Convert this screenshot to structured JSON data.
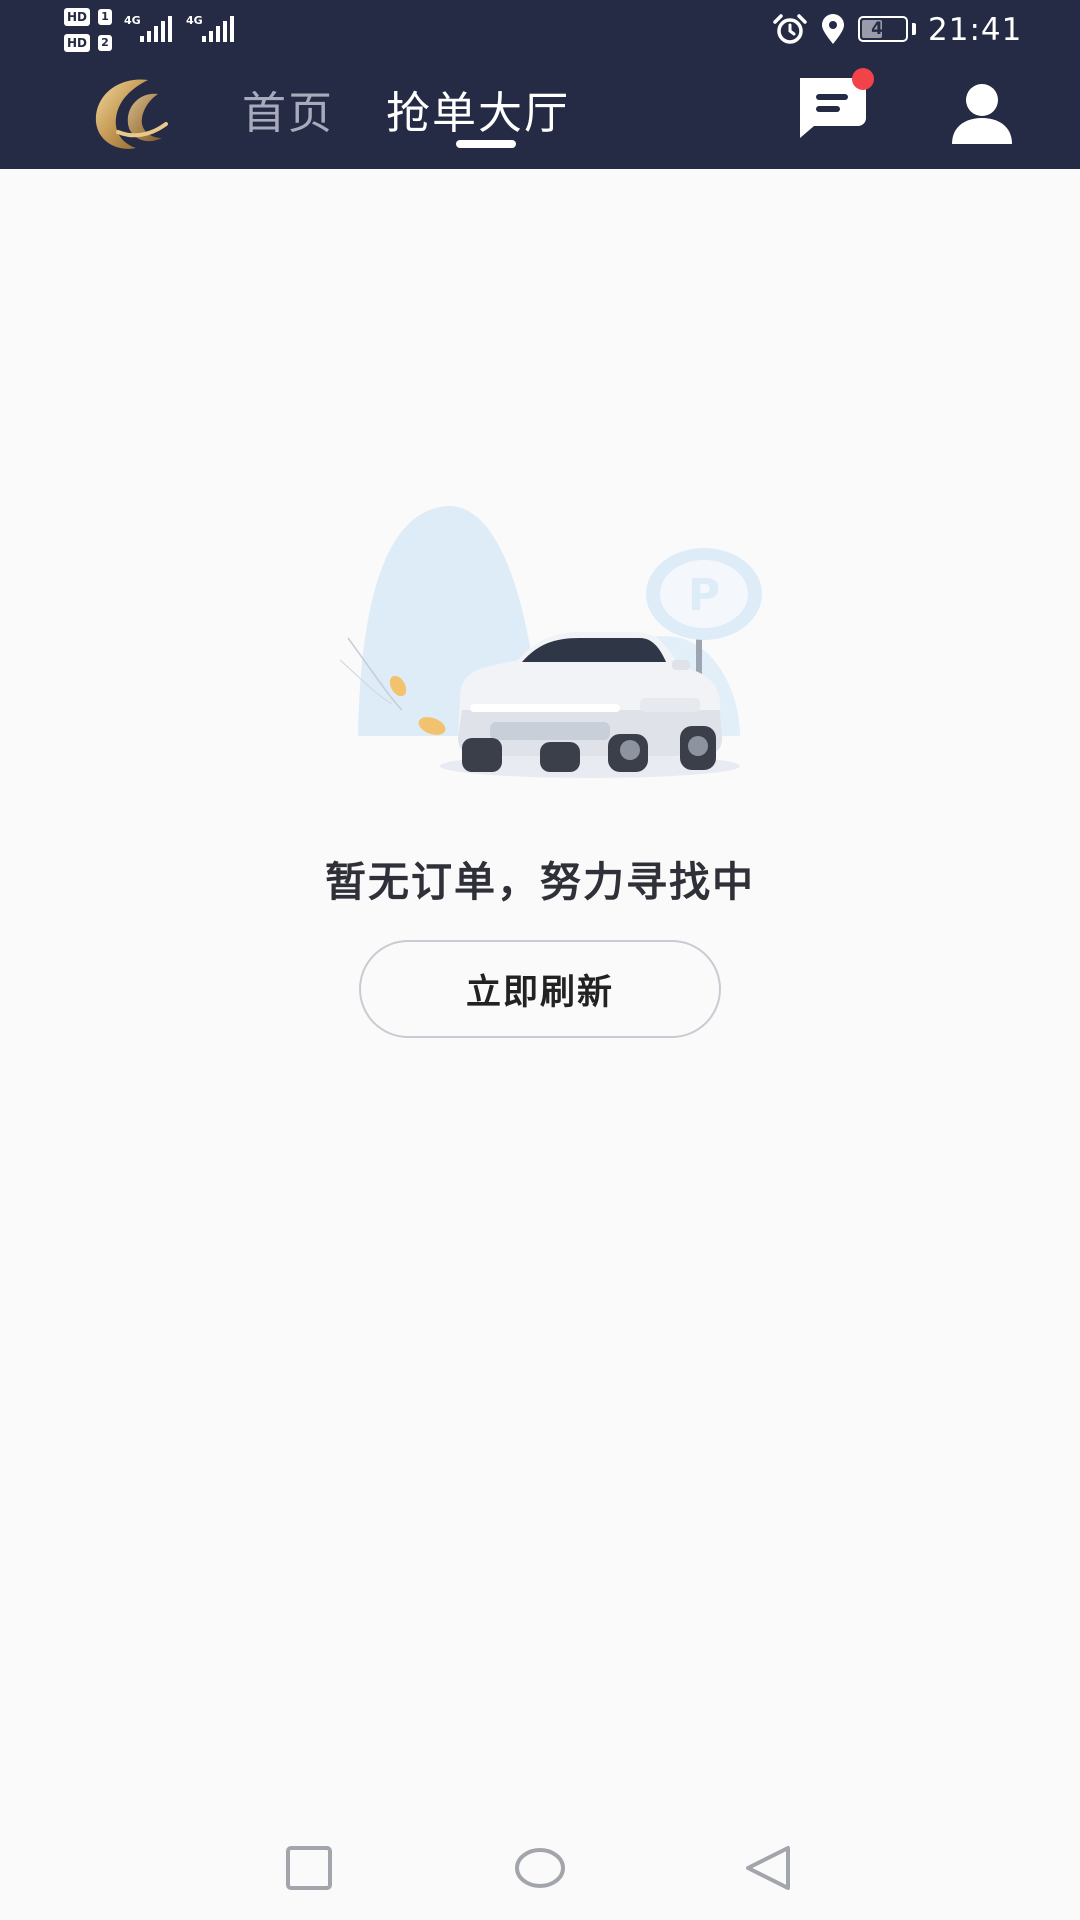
{
  "status_bar": {
    "sim1_badge": "HD",
    "sim1_number": "1",
    "sim2_badge": "HD",
    "sim2_number": "2",
    "network1": "4G",
    "network2": "4G",
    "battery_level": "45",
    "time": "21:41",
    "icons": [
      "alarm-icon",
      "location-icon",
      "battery-icon"
    ]
  },
  "app_bar": {
    "logo": "app-logo",
    "tabs": [
      {
        "label": "首页",
        "active": false
      },
      {
        "label": "抢单大厅",
        "active": true
      }
    ],
    "message_icon": "chat-icon",
    "message_badge": true,
    "profile_icon": "user-icon"
  },
  "empty_state": {
    "illustration": "parked-car-illustration",
    "message": "暂无订单，努力寻找中",
    "refresh_label": "立即刷新"
  },
  "system_nav": {
    "buttons": [
      "recent-apps-icon",
      "home-icon",
      "back-icon"
    ]
  },
  "colors": {
    "header_bg": "#262b45",
    "inactive_tab": "#a8abbb",
    "badge_red": "#f2434a",
    "page_bg": "#fafafa"
  }
}
